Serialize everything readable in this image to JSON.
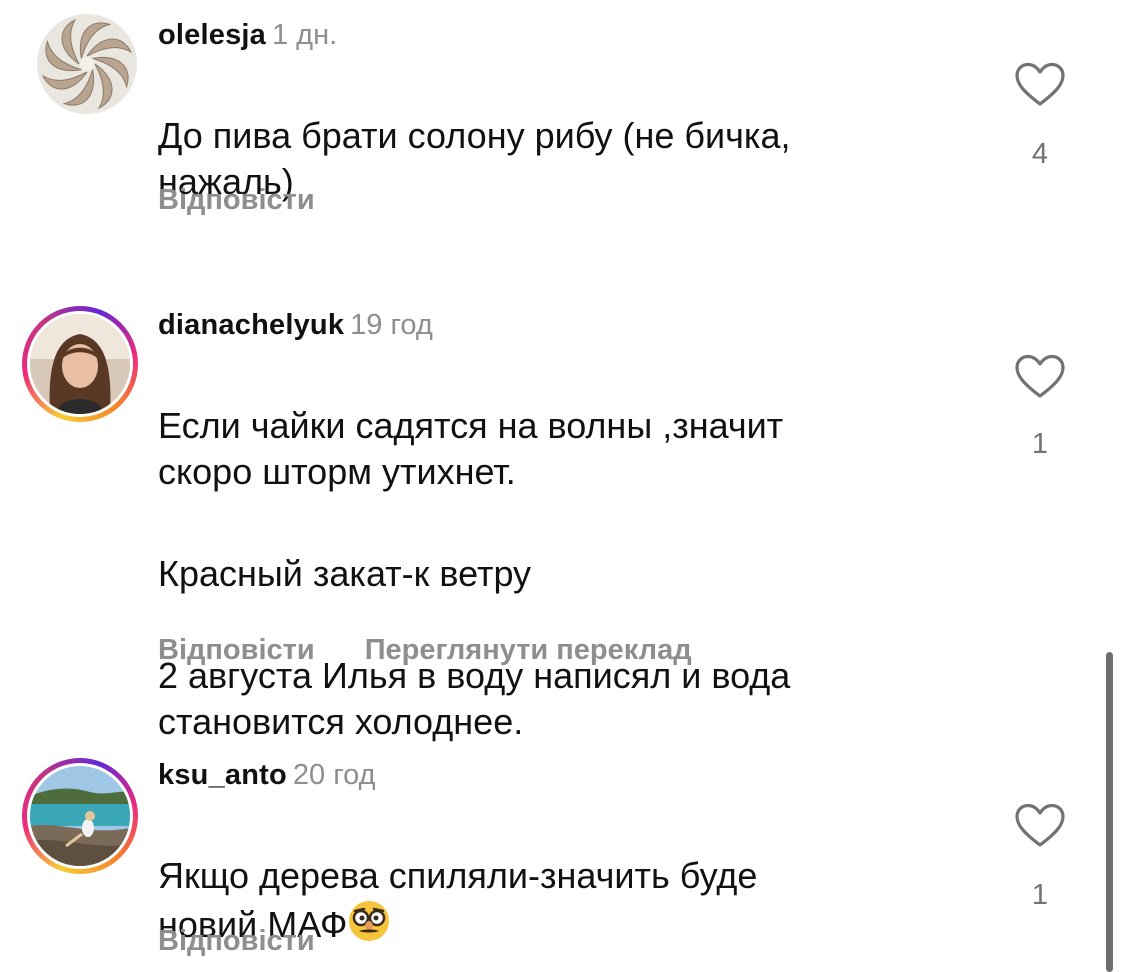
{
  "comments": [
    {
      "username": "olelesja",
      "time": "1 дн.",
      "lines": [
        "До пива брати солону рибу (не бичка,\nнажаль)"
      ],
      "reply": "Відповісти",
      "likes": "4",
      "avatar_icon": "spiral-pattern-avatar"
    },
    {
      "username": "dianachelyuk",
      "time": "19 год",
      "lines": [
        "Если чайки садятся на волны ,значит\nскоро шторм утихнет.",
        "Красный закат-к ветру",
        "2 августа Илья в воду написял и вода\nстановится холоднее."
      ],
      "reply": "Відповісти",
      "translate": "Переглянути переклад",
      "likes": "1",
      "avatar_icon": "portrait-photo-avatar"
    },
    {
      "username": "ksu_anto",
      "time": "20 год",
      "text_main": "Якщо дерева спиляли-значить буде\nновий МАФ",
      "emoji": "disguised-face-emoji",
      "reply": "Відповісти",
      "likes": "1",
      "avatar_icon": "beach-photo-avatar"
    }
  ],
  "colors": {
    "text": "#111111",
    "muted": "#8e8e8e",
    "story_ring_start": "#f9ce34",
    "story_ring_mid": "#ee2a7b",
    "story_ring_end": "#6228d7"
  }
}
